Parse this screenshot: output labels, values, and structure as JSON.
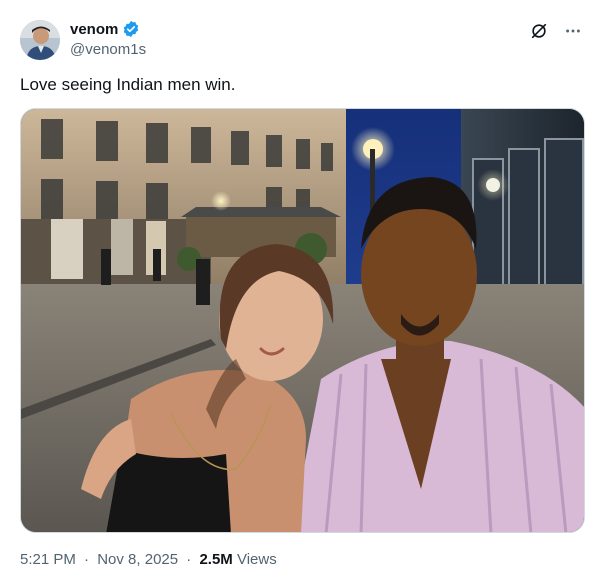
{
  "author": {
    "name": "venom",
    "handle": "@venom1s",
    "verified": true,
    "verified_color": "#1d9bf0"
  },
  "post": {
    "text": "Love seeing Indian men win.",
    "media_description_icon": "photo"
  },
  "meta": {
    "time": "5:21 PM",
    "separator": "·",
    "date": "Nov 8, 2025",
    "views_count": "2.5M",
    "views_label": "Views"
  },
  "icons": {
    "grok": "grok-slash-circle-icon",
    "more": "more-horizontal-icon"
  },
  "colors": {
    "text_primary": "#0f1419",
    "text_secondary": "#536471",
    "border": "#cfd9de"
  }
}
